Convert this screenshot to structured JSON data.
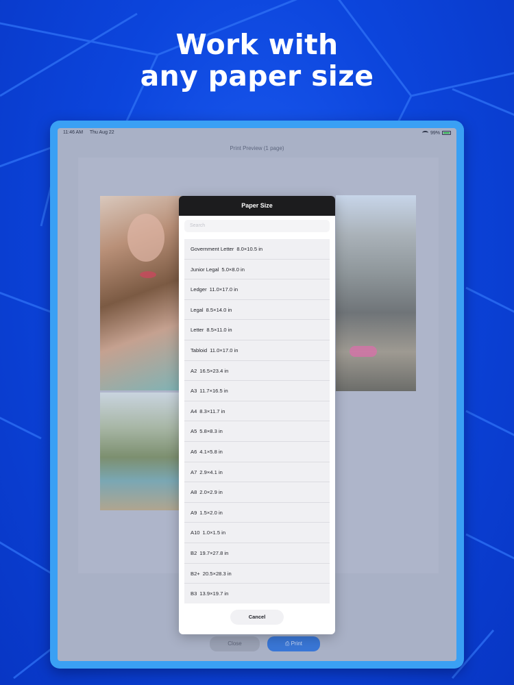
{
  "headline": {
    "line1": "Work with",
    "line2": "any paper size"
  },
  "status_bar": {
    "time": "11:46 AM",
    "date": "Thu Aug 22",
    "battery": "99%"
  },
  "print_preview": {
    "title": "Print Preview (1 page)",
    "close_label": "Close",
    "print_label": "Print"
  },
  "modal": {
    "title": "Paper Size",
    "search_placeholder": "Search",
    "cancel_label": "Cancel",
    "items": [
      {
        "name": "Government Letter",
        "size": "8.0×10.5 in"
      },
      {
        "name": "Junior Legal",
        "size": "5.0×8.0 in"
      },
      {
        "name": "Ledger",
        "size": "11.0×17.0 in"
      },
      {
        "name": "Legal",
        "size": "8.5×14.0 in"
      },
      {
        "name": "Letter",
        "size": "8.5×11.0 in"
      },
      {
        "name": "Tabloid",
        "size": "11.0×17.0 in"
      },
      {
        "name": "A2",
        "size": "16.5×23.4 in"
      },
      {
        "name": "A3",
        "size": "11.7×16.5 in"
      },
      {
        "name": "A4",
        "size": "8.3×11.7 in"
      },
      {
        "name": "A5",
        "size": "5.8×8.3 in"
      },
      {
        "name": "A6",
        "size": "4.1×5.8 in"
      },
      {
        "name": "A7",
        "size": "2.9×4.1 in"
      },
      {
        "name": "A8",
        "size": "2.0×2.9 in"
      },
      {
        "name": "A9",
        "size": "1.5×2.0 in"
      },
      {
        "name": "A10",
        "size": "1.0×1.5 in"
      },
      {
        "name": "B2",
        "size": "19.7×27.8 in"
      },
      {
        "name": "B2+",
        "size": "20.5×28.3 in"
      },
      {
        "name": "B3",
        "size": "13.9×19.7 in"
      }
    ]
  },
  "colors": {
    "background": "#0a3fd6",
    "device_frame": "#3aa0f4",
    "modal_header": "#1c1c1e",
    "print_button": "#3976d6"
  }
}
